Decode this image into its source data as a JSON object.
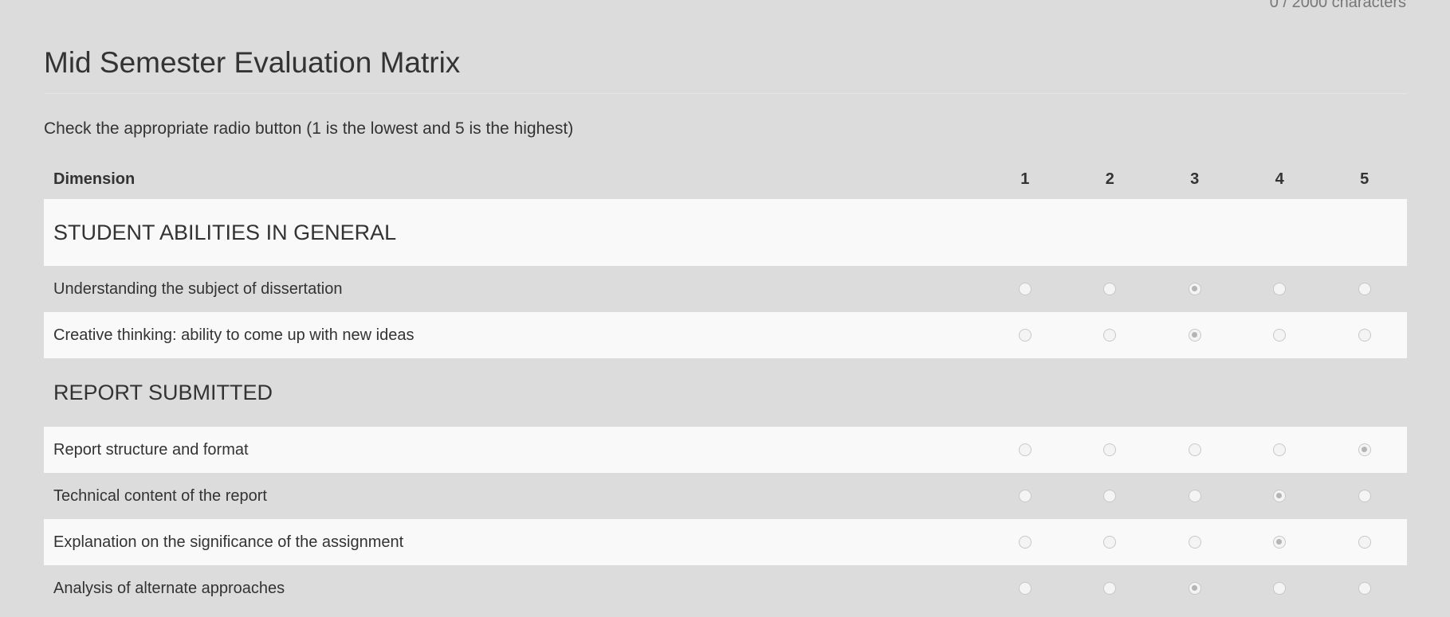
{
  "char_counter": "0 / 2000 characters",
  "page_title": "Mid Semester Evaluation Matrix",
  "instructions": "Check the appropriate radio button (1 is the lowest and 5 is the highest)",
  "table": {
    "dimension_header": "Dimension",
    "score_headers": [
      "1",
      "2",
      "3",
      "4",
      "5"
    ]
  },
  "sections": [
    {
      "title": "STUDENT ABILITIES IN GENERAL",
      "items": [
        {
          "label": "Understanding the subject of dissertation",
          "selected": 3
        },
        {
          "label": "Creative thinking: ability to come up with new ideas",
          "selected": 3
        }
      ]
    },
    {
      "title": "REPORT SUBMITTED",
      "items": [
        {
          "label": "Report structure and format",
          "selected": 5
        },
        {
          "label": "Technical content of the report",
          "selected": 4
        },
        {
          "label": "Explanation on the significance of the assignment",
          "selected": 4
        },
        {
          "label": "Analysis of alternate approaches",
          "selected": 3
        }
      ]
    }
  ]
}
